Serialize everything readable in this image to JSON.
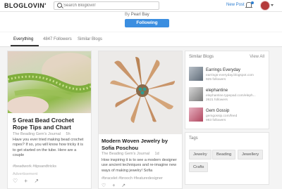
{
  "header": {
    "logo": "BLOGLOVIN'",
    "search_placeholder": "Search Bloglovin'",
    "new_post": "New Post"
  },
  "profile": {
    "by_prefix": "By",
    "author": "Pearl Bay",
    "follow_label": "Following"
  },
  "tabs": [
    {
      "label": "Everything",
      "active": true
    },
    {
      "label": "4847 Followers",
      "active": false
    },
    {
      "label": "Similar Blogs",
      "active": false
    }
  ],
  "posts": [
    {
      "title": "5 Great Bead Crochet Rope Tips and Chart",
      "source": "The Beading Gem's Journal",
      "age": "5h",
      "excerpt": "Have you ever tried making bead crochet ropes? If so, you will know how tricky it is to get started on the tube. Here are a couple",
      "tags": "#beadwork   #tipsandtricks",
      "advertisement": "Advertisement"
    },
    {
      "title": "Modern Woven Jewelry by Sofia Poschou",
      "source": "The Beading Gem's Journal",
      "age": "1d",
      "excerpt": "How inspiring it is to see a modern designer use ancient techniques and re-imagine new ways of making jewelry! Sofia",
      "tags": "#bracelet   #brooch   #featuredesigner"
    }
  ],
  "similar_blogs": {
    "heading": "Similar Blogs",
    "view_all": "View All",
    "items": [
      {
        "name": "Earrings Everyday",
        "url": "earrings-everyday.blogspot.com",
        "followers": "925 followers"
      },
      {
        "name": "elephantine",
        "url": "elephantine.typepad.com/eleph...",
        "followers": "2621 followers"
      },
      {
        "name": "Gem Gossip",
        "url": "gemgossip.com/feed",
        "followers": "983 followers"
      }
    ]
  },
  "tags_box": {
    "heading": "Tags",
    "tags": [
      "Jewelry",
      "Beading",
      "Jewellery",
      "Crafts"
    ]
  },
  "colors": {
    "accent": "#3b8ee0",
    "link": "#2f7fd1"
  }
}
